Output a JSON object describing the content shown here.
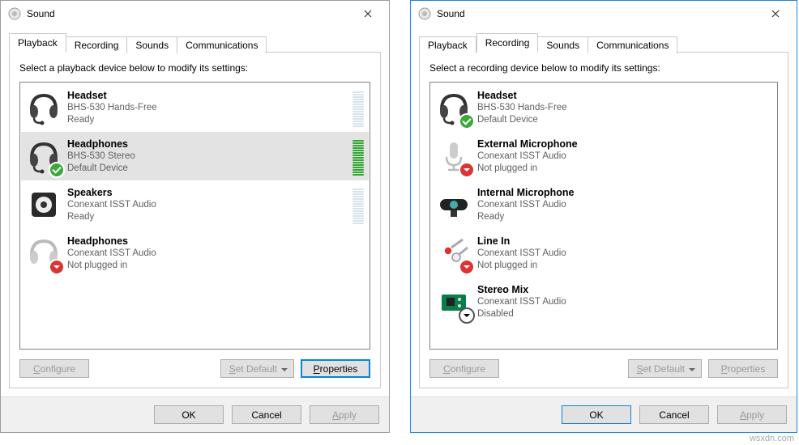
{
  "dialogs": [
    {
      "title": "Sound",
      "activeTab": 0,
      "tabs": [
        "Playback",
        "Recording",
        "Sounds",
        "Communications"
      ],
      "instruction": "Select a playback device below to modify its settings:",
      "devices": [
        {
          "name": "Headset",
          "sub": "BHS-530 Hands-Free",
          "status": "Ready",
          "icon": "headset",
          "badge": "none",
          "selected": false,
          "meter": "idle"
        },
        {
          "name": "Headphones",
          "sub": "BHS-530 Stereo",
          "status": "Default Device",
          "icon": "headset",
          "badge": "check",
          "selected": true,
          "meter": "full"
        },
        {
          "name": "Speakers",
          "sub": "Conexant ISST Audio",
          "status": "Ready",
          "icon": "speakers",
          "badge": "none",
          "selected": false,
          "meter": "idle"
        },
        {
          "name": "Headphones",
          "sub": "Conexant ISST Audio",
          "status": "Not plugged in",
          "icon": "headset-dim",
          "badge": "unplug",
          "selected": false,
          "meter": "none"
        }
      ],
      "buttons": {
        "configure": "Configure",
        "setDefault": "Set Default",
        "properties": "Properties",
        "configureDisabled": true,
        "setDefaultDisabled": true,
        "propertiesDisabled": false
      },
      "footer": {
        "ok": "OK",
        "cancel": "Cancel",
        "apply": "Apply",
        "applyDisabled": true
      }
    },
    {
      "title": "Sound",
      "activeTab": 1,
      "tabs": [
        "Playback",
        "Recording",
        "Sounds",
        "Communications"
      ],
      "instruction": "Select a recording device below to modify its settings:",
      "devices": [
        {
          "name": "Headset",
          "sub": "BHS-530 Hands-Free",
          "status": "Default Device",
          "icon": "headset",
          "badge": "check",
          "selected": false,
          "meter": "none"
        },
        {
          "name": "External Microphone",
          "sub": "Conexant ISST Audio",
          "status": "Not plugged in",
          "icon": "mic-dim",
          "badge": "unplug",
          "selected": false,
          "meter": "none"
        },
        {
          "name": "Internal Microphone",
          "sub": "Conexant ISST Audio",
          "status": "Ready",
          "icon": "webcam",
          "badge": "none",
          "selected": false,
          "meter": "none"
        },
        {
          "name": "Line In",
          "sub": "Conexant ISST Audio",
          "status": "Not plugged in",
          "icon": "linein",
          "badge": "unplug",
          "selected": false,
          "meter": "none"
        },
        {
          "name": "Stereo Mix",
          "sub": "Conexant ISST Audio",
          "status": "Disabled",
          "icon": "chip",
          "badge": "disable",
          "selected": false,
          "meter": "none"
        }
      ],
      "buttons": {
        "configure": "Configure",
        "setDefault": "Set Default",
        "properties": "Properties",
        "configureDisabled": true,
        "setDefaultDisabled": true,
        "propertiesDisabled": true
      },
      "footer": {
        "ok": "OK",
        "cancel": "Cancel",
        "apply": "Apply",
        "applyDisabled": true
      }
    }
  ],
  "watermark": "wsxdn.com"
}
